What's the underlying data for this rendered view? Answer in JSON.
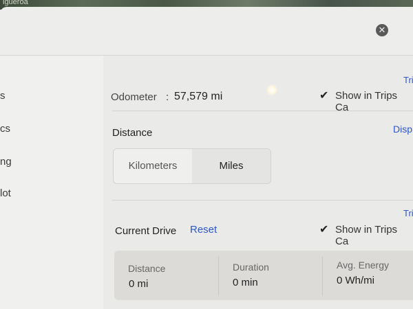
{
  "map": {
    "label": "igueroa"
  },
  "window": {
    "close_icon": "close-icon"
  },
  "sidebar": {
    "items": [
      {
        "label": "s"
      },
      {
        "label": "cs"
      },
      {
        "label": "ng"
      },
      {
        "label": "lot"
      }
    ]
  },
  "odometer": {
    "label": "Odometer",
    "separator": ":",
    "value": "57,579 mi",
    "trips_link": "Tri",
    "show_in_trips": "Show in Trips Ca"
  },
  "distance": {
    "title": "Distance",
    "display_link": "Disp",
    "options": [
      "Kilometers",
      "Miles"
    ],
    "selected": "Miles"
  },
  "current_drive": {
    "title": "Current Drive",
    "reset_label": "Reset",
    "trips_link": "Tri",
    "show_in_trips": "Show in Trips Ca",
    "stats": [
      {
        "label": "Distance",
        "value": "0 mi"
      },
      {
        "label": "Duration",
        "value": "0 min"
      },
      {
        "label": "Avg. Energy",
        "value": "0 Wh/mi"
      }
    ]
  }
}
